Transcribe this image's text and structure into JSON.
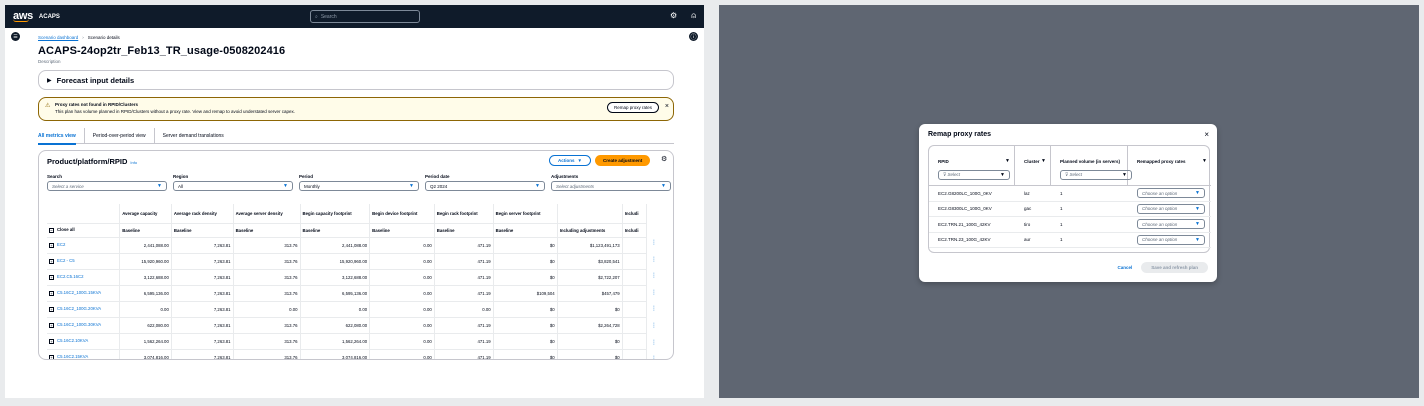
{
  "topnav": {
    "logo": "aws",
    "app_name": "ACAPS",
    "search_placeholder": "Search"
  },
  "breadcrumb": {
    "link": "Scenario dashboard",
    "current": "Scenario details"
  },
  "page": {
    "title": "ACAPS-24op2tr_Feb13_TR_usage-0508202416",
    "description": "Description"
  },
  "forecast": {
    "label": "Forecast input details"
  },
  "alert": {
    "title": "Proxy rates not found in RPID/Clusters",
    "message": "This plan has volume planned in RPID/Clusters without a proxy rate. View and remap to avoid understated server capex.",
    "button": "Remap proxy rates"
  },
  "tabs": [
    {
      "label": "All metrics view"
    },
    {
      "label": "Period-over-period view"
    },
    {
      "label": "Server demand translations"
    }
  ],
  "card": {
    "title": "Product/platform/RPID",
    "info": "Info",
    "actions": "Actions",
    "create": "Create adjustment"
  },
  "filters": [
    {
      "label": "Search",
      "value": "Select a service",
      "placeholder": true
    },
    {
      "label": "Region",
      "value": "All",
      "placeholder": false
    },
    {
      "label": "Period",
      "value": "Monthly",
      "placeholder": false
    },
    {
      "label": "Period date",
      "value": "Q2 2024",
      "placeholder": false
    },
    {
      "label": "Adjustments",
      "value": "Select adjustments",
      "placeholder": true
    }
  ],
  "grid": {
    "headers": [
      "",
      "Average capacity",
      "Average rack density",
      "Average server density",
      "Begin capacity footprint",
      "Begin device footprint",
      "Begin rack footprint",
      "Begin server footprint",
      "",
      "Includi"
    ],
    "subheaders": [
      "Close all",
      "Baseline",
      "Baseline",
      "Baseline",
      "Baseline",
      "Baseline",
      "Baseline",
      "Baseline",
      "Including adjustments",
      "Includi"
    ],
    "rows": [
      [
        "EC2",
        "2,441,088.00",
        "7,263.81",
        "313.76",
        "2,441,088.00",
        "0.00",
        "471.19",
        "$0",
        "$1,123,491,173",
        ""
      ],
      [
        "EC2 - C5",
        "15,920,960.00",
        "7,263.81",
        "313.76",
        "15,920,960.00",
        "0.00",
        "471.19",
        "$0",
        "$3,820,541",
        ""
      ],
      [
        "EC2.C5.16C2",
        "3,122,688.00",
        "7,263.81",
        "313.76",
        "3,122,688.00",
        "0.00",
        "471.19",
        "$0",
        "$2,722,207",
        ""
      ],
      [
        "C5.16C2_100G.15KVA",
        "6,595,136.00",
        "7,263.81",
        "313.76",
        "6,595,136.00",
        "0.00",
        "471.19",
        "$109,504",
        "$457,479",
        ""
      ],
      [
        "C5.16C2_100G.20KVA",
        "0.00",
        "7,263.81",
        "0.00",
        "0.00",
        "0.00",
        "0.00",
        "$0",
        "$0",
        ""
      ],
      [
        "C5.16C2_100G.30KVA",
        "622,080.00",
        "7,263.81",
        "313.76",
        "622,080.00",
        "0.00",
        "471.19",
        "$0",
        "$2,264,728",
        ""
      ],
      [
        "C5.16C2.10KVA",
        "1,562,264.00",
        "7,263.81",
        "313.76",
        "1,562,264.00",
        "0.00",
        "471.19",
        "$0",
        "$0",
        ""
      ],
      [
        "C5.16C2.15KVA",
        "3,074,816.00",
        "7,263.81",
        "313.76",
        "3,074,816.00",
        "0.00",
        "471.19",
        "$0",
        "$0",
        ""
      ]
    ]
  },
  "modal": {
    "title": "Remap proxy rates",
    "headers": [
      "RPID",
      "Cluster",
      "Planned volume (in servers)",
      "Remapped proxy rates"
    ],
    "filter_placeholder": "Select",
    "option_placeholder": "Choose an option",
    "rows": [
      {
        "rpid": "EC2.G8200LC_100G_0KV",
        "cluster": "laz",
        "volume": "1"
      },
      {
        "rpid": "EC2.G8300LC_100G_0KV",
        "cluster": "gac",
        "volume": "1"
      },
      {
        "rpid": "EC2.TRN.21_100G_42KV",
        "cluster": "tiro",
        "volume": "1"
      },
      {
        "rpid": "EC2.TRN.23_100G_42KV",
        "cluster": "aur",
        "volume": "1"
      }
    ],
    "cancel": "Cancel",
    "save": "Save and refresh plan"
  },
  "colors": {
    "nav": "#0f1b2a",
    "link": "#0972d3",
    "primary": "#ff9900",
    "warning_border": "#8d6605",
    "overlay": "#5f6672"
  }
}
